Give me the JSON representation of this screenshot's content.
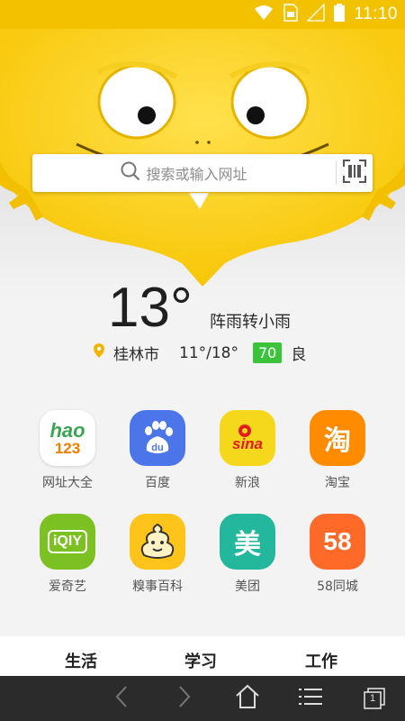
{
  "status_bar": {
    "time": "11:10",
    "icons": [
      "wifi-icon",
      "sim-icon",
      "signal-icon",
      "battery-icon"
    ]
  },
  "search": {
    "placeholder": "搜索或输入网址"
  },
  "weather": {
    "temperature": "13°",
    "description": "阵雨转小雨",
    "city": "桂林市",
    "range": "11°/18°",
    "aqi_value": "70",
    "aqi_level": "良"
  },
  "shortcuts": [
    {
      "label": "网址大全",
      "icon": "hao123-icon",
      "color": "#ffffff"
    },
    {
      "label": "百度",
      "icon": "baidu-paw-icon",
      "color": "#4b75e8"
    },
    {
      "label": "新浪",
      "icon": "sina-icon",
      "color": "#f5d81b"
    },
    {
      "label": "淘宝",
      "icon": "taobao-icon",
      "color": "#ff8c00"
    },
    {
      "label": "爱奇艺",
      "icon": "iqiyi-icon",
      "color": "#7cc122"
    },
    {
      "label": "糗事百科",
      "icon": "qiushi-icon",
      "color": "#ffc419"
    },
    {
      "label": "美团",
      "icon": "meituan-icon",
      "color": "#23b79e"
    },
    {
      "label": "58同城",
      "icon": "58-icon",
      "color": "#ff6a28"
    }
  ],
  "icon_text": {
    "hao": "hao",
    "n123": "123",
    "du": "du",
    "sina": "sina",
    "tao": "淘",
    "iqiyi": "iQIY",
    "mei": "美",
    "n58": "58"
  },
  "tabs": [
    "生活",
    "学习",
    "工作"
  ],
  "navbar": {
    "tab_count": "1"
  },
  "colors": {
    "accent": "#f2c200",
    "mascot": "#ffd21f",
    "navbar": "#2b2b2b"
  }
}
